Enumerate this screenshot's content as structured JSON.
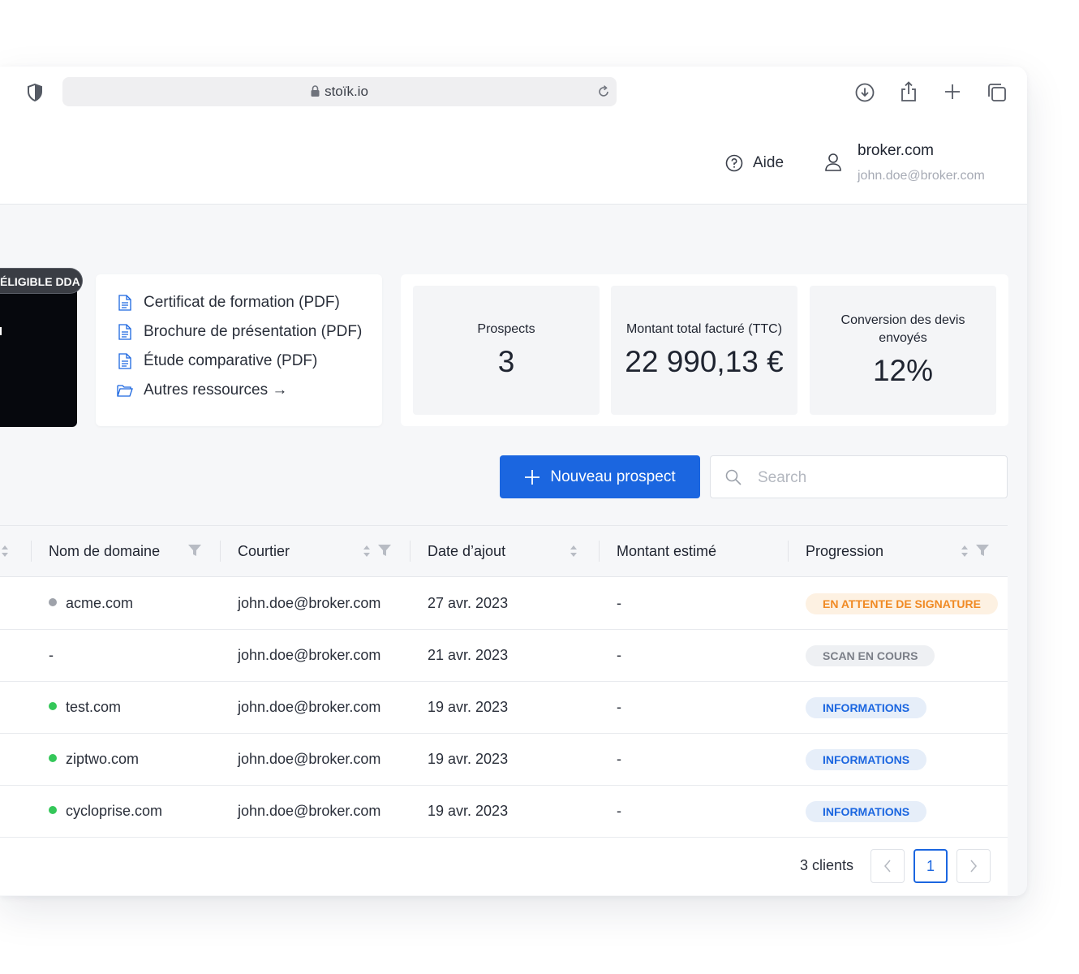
{
  "browser": {
    "url": "stoïk.io"
  },
  "header": {
    "help_label": "Aide",
    "broker_name": "broker.com",
    "broker_email": "john.doe@broker.com"
  },
  "banner": {
    "badge": "ÉLIGIBLE DDA"
  },
  "resources": [
    {
      "label": "Certificat de formation (PDF)",
      "icon": "document-icon"
    },
    {
      "label": "Brochure de présentation (PDF)",
      "icon": "document-icon"
    },
    {
      "label": "Étude comparative (PDF)",
      "icon": "document-icon"
    },
    {
      "label": "Autres ressources →",
      "icon": "folder-icon"
    }
  ],
  "stats": {
    "prospects_label": "Prospects",
    "prospects_value": "3",
    "billed_label": "Montant total facturé (TTC)",
    "billed_value": "22 990,13 €",
    "conversion_label": "Conversion des devis envoyés",
    "conversion_value": "12%"
  },
  "actions": {
    "new_prospect": "Nouveau prospect",
    "search_placeholder": "Search"
  },
  "table": {
    "columns": {
      "domain": "Nom de domaine",
      "broker": "Courtier",
      "date": "Date d’ajout",
      "amount": "Montant estimé",
      "progress": "Progression"
    },
    "rows": [
      {
        "domain": "acme.com",
        "dot": "#9ea2aa",
        "broker": "john.doe@broker.com",
        "date": "27 avr. 2023",
        "amount": "-",
        "status": "EN ATTENTE DE SIGNATURE",
        "status_color": "#f08a24",
        "status_bg": "#fdf1e2"
      },
      {
        "domain": "-",
        "dot": "",
        "broker": "john.doe@broker.com",
        "date": "21 avr. 2023",
        "amount": "-",
        "status": "SCAN EN COURS",
        "status_color": "#7b7f88",
        "status_bg": "#eef0f3"
      },
      {
        "domain": "test.com",
        "dot": "#34c759",
        "broker": "john.doe@broker.com",
        "date": "19 avr. 2023",
        "amount": "-",
        "status": "INFORMATIONS",
        "status_color": "#1b66e0",
        "status_bg": "#e6eef9"
      },
      {
        "domain": "ziptwo.com",
        "dot": "#34c759",
        "broker": "john.doe@broker.com",
        "date": "19 avr. 2023",
        "amount": "-",
        "status": "INFORMATIONS",
        "status_color": "#1b66e0",
        "status_bg": "#e6eef9"
      },
      {
        "domain": "cycloprise.com",
        "dot": "#34c759",
        "broker": "john.doe@broker.com",
        "date": "19 avr. 2023",
        "amount": "-",
        "status": "INFORMATIONS",
        "status_color": "#1b66e0",
        "status_bg": "#e6eef9"
      }
    ]
  },
  "pagination": {
    "count_label": "3 clients",
    "current_page": "1"
  },
  "colors": {
    "primary": "#1b66e0",
    "background": "#f6f7f9"
  }
}
